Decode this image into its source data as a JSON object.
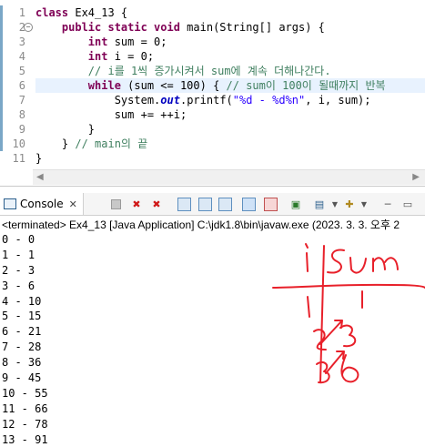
{
  "editor": {
    "line_numbers": [
      "1",
      "2",
      "3",
      "4",
      "5",
      "6",
      "7",
      "8",
      "9",
      "10",
      "11"
    ],
    "lines": [
      {
        "indent": "",
        "segments": [
          {
            "kind": "kw",
            "text": "class"
          },
          {
            "kind": "plain",
            "text": " Ex4_13 {"
          }
        ]
      },
      {
        "indent": "    ",
        "segments": [
          {
            "kind": "kw",
            "text": "public static void"
          },
          {
            "kind": "plain",
            "text": " main(String[] args) {"
          }
        ]
      },
      {
        "indent": "        ",
        "segments": [
          {
            "kind": "kw",
            "text": "int"
          },
          {
            "kind": "plain",
            "text": " sum = 0;"
          }
        ]
      },
      {
        "indent": "        ",
        "segments": [
          {
            "kind": "kw",
            "text": "int"
          },
          {
            "kind": "plain",
            "text": " i = 0;"
          }
        ]
      },
      {
        "indent": "        ",
        "segments": [
          {
            "kind": "cm",
            "text": "// i를 1씩 증가시켜서 sum에 계속 더해나간다."
          }
        ]
      },
      {
        "indent": "        ",
        "segments": [
          {
            "kind": "kw",
            "text": "while"
          },
          {
            "kind": "plain",
            "text": " (sum <= 100) { "
          },
          {
            "kind": "cm",
            "text": "// sum이 100이 될때까지 반복"
          }
        ]
      },
      {
        "indent": "            ",
        "segments": [
          {
            "kind": "plain",
            "text": "System."
          },
          {
            "kind": "fi",
            "text": "out"
          },
          {
            "kind": "plain",
            "text": ".printf("
          },
          {
            "kind": "st",
            "text": "\"%d - %d%n\""
          },
          {
            "kind": "plain",
            "text": ", i, sum);"
          }
        ]
      },
      {
        "indent": "            ",
        "segments": [
          {
            "kind": "plain",
            "text": "sum += ++i;"
          }
        ]
      },
      {
        "indent": "        ",
        "segments": [
          {
            "kind": "plain",
            "text": "}"
          }
        ]
      },
      {
        "indent": "    ",
        "segments": [
          {
            "kind": "plain",
            "text": "} "
          },
          {
            "kind": "cm",
            "text": "// main의 끝"
          }
        ]
      },
      {
        "indent": "",
        "segments": [
          {
            "kind": "plain",
            "text": "}"
          }
        ]
      }
    ],
    "current_line": 6
  },
  "console": {
    "tab_label": "Console",
    "status": "<terminated> Ex4_13 [Java Application] C:\\jdk1.8\\bin\\javaw.exe (2023. 3. 3. 오후 2",
    "output_lines": [
      "0 - 0",
      "1 - 1",
      "2 - 3",
      "3 - 6",
      "4 - 10",
      "5 - 15",
      "6 - 21",
      "7 - 28",
      "8 - 36",
      "9 - 45",
      "10 - 55",
      "11 - 66",
      "12 - 78",
      "13 - 91"
    ]
  },
  "handwriting": {
    "color": "#e8202a",
    "glyphs": [
      "i",
      "sum",
      "1",
      "1",
      "2",
      "3",
      "3",
      "6"
    ]
  }
}
